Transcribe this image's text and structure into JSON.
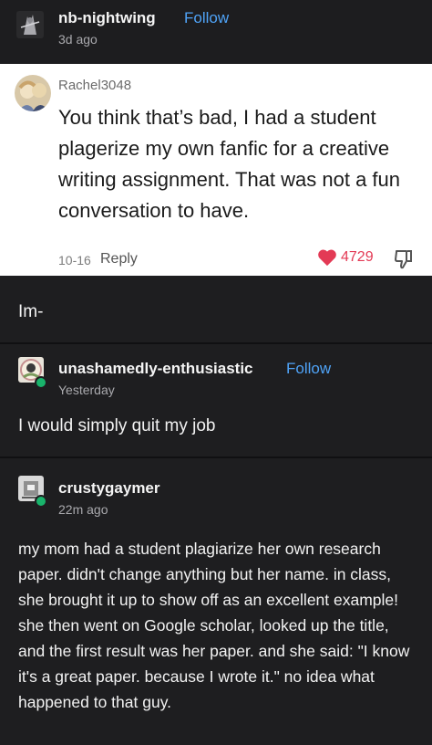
{
  "post": {
    "username": "nb-nightwing",
    "follow_label": "Follow",
    "time": "3d ago"
  },
  "quoted_comment": {
    "username": "Rachel3048",
    "text": "You think that’s bad, I had a student plagerize my own fanfic for a creative writing assignment. That was not a fun conversation to have.",
    "date": "10-16",
    "reply_label": "Reply",
    "likes": "4729",
    "like_color": "#e33a55"
  },
  "op_caption": "Im-",
  "reblog1": {
    "username": "unashamedly-enthusiastic",
    "follow_label": "Follow",
    "time": "Yesterday",
    "text": "I would simply quit my job"
  },
  "reblog2": {
    "username": "crustygaymer",
    "time": "22m ago",
    "text": "my mom had a student plagiarize her own research paper. didn't change anything but her name. in class, she brought it up to show off as an excellent example! she then went on Google scholar, looked up the title, and the first result was her paper. and she said: \"I know it's a great paper. because I wrote it.\" no idea what happened to that guy."
  },
  "colors": {
    "follow": "#4fa3f7",
    "reblog_badge": "#19b36b"
  }
}
